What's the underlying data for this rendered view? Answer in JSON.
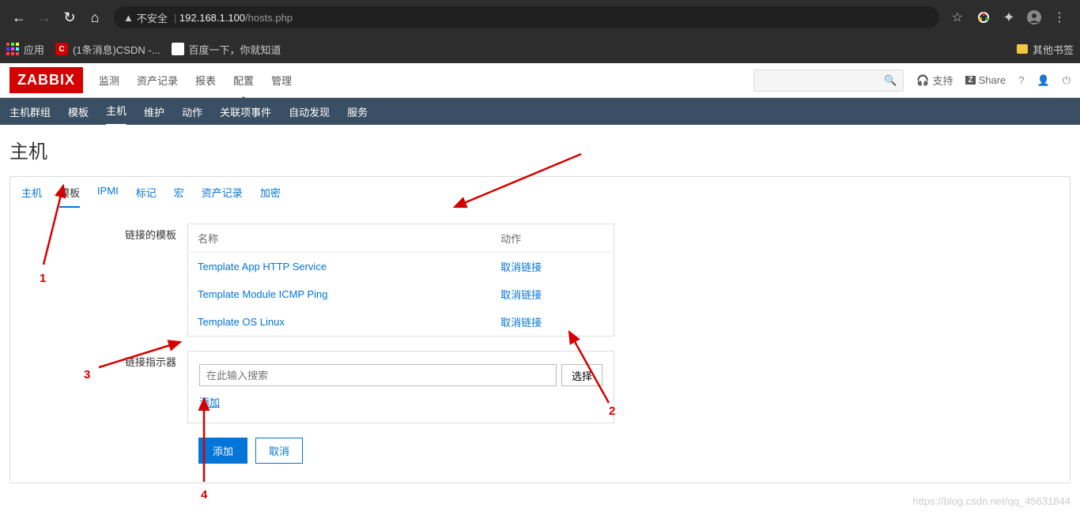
{
  "browser": {
    "insecure_label": "不安全",
    "url_host": "192.168.1.100",
    "url_path": "/hosts.php"
  },
  "bookmarks": {
    "apps": "应用",
    "csdn": "(1条消息)CSDN -...",
    "baidu": "百度一下，你就知道",
    "other": "其他书签"
  },
  "header": {
    "logo": "ZABBIX",
    "nav": {
      "monitor": "监测",
      "asset": "资产记录",
      "report": "报表",
      "config": "配置",
      "manage": "管理"
    },
    "support": "支持",
    "share": "Share"
  },
  "subnav": {
    "hostgroup": "主机群组",
    "template": "模板",
    "host": "主机",
    "maintenance": "维护",
    "action": "动作",
    "correlation": "关联项事件",
    "discovery": "自动发现",
    "service": "服务"
  },
  "page": {
    "title": "主机"
  },
  "tabs": {
    "host": "主机",
    "template": "模板",
    "ipmi": "IPMI",
    "tag": "标记",
    "macro": "宏",
    "asset": "资产记录",
    "encrypt": "加密"
  },
  "form": {
    "linked_label": "链接的模板",
    "col_name": "名称",
    "col_action": "动作",
    "templates": [
      {
        "name": "Template App HTTP Service",
        "action": "取消链接"
      },
      {
        "name": "Template Module ICMP Ping",
        "action": "取消链接"
      },
      {
        "name": "Template OS Linux",
        "action": "取消链接"
      }
    ],
    "linker_label": "链接指示器",
    "search_placeholder": "在此输入搜索",
    "select_btn": "选择",
    "add_link": "添加",
    "submit": "添加",
    "cancel": "取消"
  },
  "annotations": {
    "n1": "1",
    "n2": "2",
    "n3": "3",
    "n4": "4"
  },
  "watermark": "https://blog.csdn.net/qq_45631844"
}
